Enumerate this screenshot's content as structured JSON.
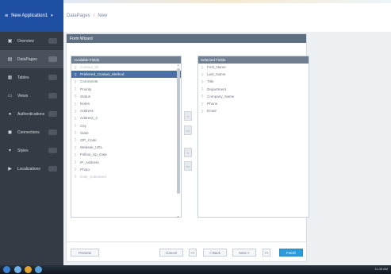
{
  "app": {
    "name": "New Application1",
    "menu_icon": "hamburger-icon",
    "caret_icon": "caret-down-icon"
  },
  "breadcrumb": {
    "root": "DataPages",
    "sep": "/",
    "current": "New"
  },
  "sidebar": {
    "items": [
      {
        "label": "Overview",
        "icon": "overview-icon",
        "glyph": "▣",
        "active": false
      },
      {
        "label": "DataPages",
        "icon": "datapages-icon",
        "glyph": "▤",
        "active": true
      },
      {
        "label": "Tables",
        "icon": "tables-icon",
        "glyph": "▦",
        "active": false
      },
      {
        "label": "Views",
        "icon": "views-icon",
        "glyph": "▭",
        "active": false
      },
      {
        "label": "Authentications",
        "icon": "auth-icon",
        "glyph": "●",
        "active": false
      },
      {
        "label": "Connections",
        "icon": "connections-icon",
        "glyph": "◼",
        "active": false
      },
      {
        "label": "Styles",
        "icon": "styles-icon",
        "glyph": "▾",
        "active": false
      },
      {
        "label": "Localizations",
        "icon": "localizations-icon",
        "glyph": "▶",
        "active": false
      }
    ]
  },
  "wizard": {
    "title": "Form Wizard",
    "available": {
      "title": "Available Fields",
      "fields": [
        {
          "label": "Contact_ID",
          "state": "disabled"
        },
        {
          "label": "Preferred_Contact_Method",
          "state": "selected"
        },
        {
          "label": "Comments",
          "state": "normal"
        },
        {
          "label": "Priority",
          "state": "normal"
        },
        {
          "label": "Status",
          "state": "normal"
        },
        {
          "label": "Notes",
          "state": "normal"
        },
        {
          "label": "Address",
          "state": "normal"
        },
        {
          "label": "Address_2",
          "state": "normal"
        },
        {
          "label": "City",
          "state": "normal"
        },
        {
          "label": "State",
          "state": "normal"
        },
        {
          "label": "ZIP_Code",
          "state": "normal"
        },
        {
          "label": "Website_URL",
          "state": "normal"
        },
        {
          "label": "Follow_Up_Date",
          "state": "normal"
        },
        {
          "label": "IP_Address",
          "state": "normal"
        },
        {
          "label": "Photo",
          "state": "normal"
        },
        {
          "label": "Date_Submitted",
          "state": "disabled"
        }
      ]
    },
    "selected": {
      "title": "Selected Fields",
      "fields": [
        "First_Name",
        "Last_Name",
        "Title",
        "Department",
        "Company_Name",
        "Phone",
        "Email"
      ]
    },
    "move_buttons": [
      ">",
      ">>",
      "<",
      "<<"
    ],
    "footer": {
      "preview": "Preview",
      "cancel": "Cancel",
      "first": "<<",
      "back": "< Back",
      "next": "Next >",
      "last": ">>",
      "finish": "Finish"
    }
  },
  "taskbar": {
    "time": "11:45 AM"
  }
}
